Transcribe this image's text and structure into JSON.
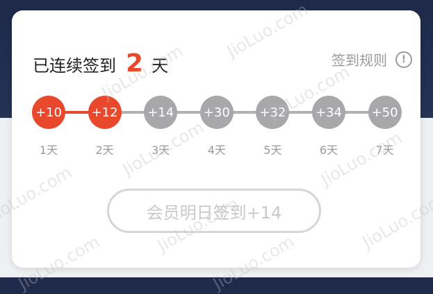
{
  "streak": {
    "prefix": "已连续签到",
    "count": "2",
    "suffix": "天"
  },
  "rules": {
    "label": "签到规则",
    "icon": "info-icon",
    "icon_glyph": "!"
  },
  "progress": {
    "completed_days": 2
  },
  "days": [
    {
      "points": "+10",
      "label": "1天",
      "active": true
    },
    {
      "points": "+12",
      "label": "2天",
      "active": true
    },
    {
      "points": "+14",
      "label": "3天",
      "active": false
    },
    {
      "points": "+30",
      "label": "4天",
      "active": false
    },
    {
      "points": "+32",
      "label": "5天",
      "active": false
    },
    {
      "points": "+34",
      "label": "6天",
      "active": false
    },
    {
      "points": "+50",
      "label": "7天",
      "active": false
    }
  ],
  "signin_button": {
    "label": "会员明日签到+14"
  },
  "watermark": {
    "text": "JioLuo.com"
  },
  "colors": {
    "accent": "#e8482b",
    "inactive": "#a8a8aa",
    "muted_text": "#9a9a9a"
  }
}
